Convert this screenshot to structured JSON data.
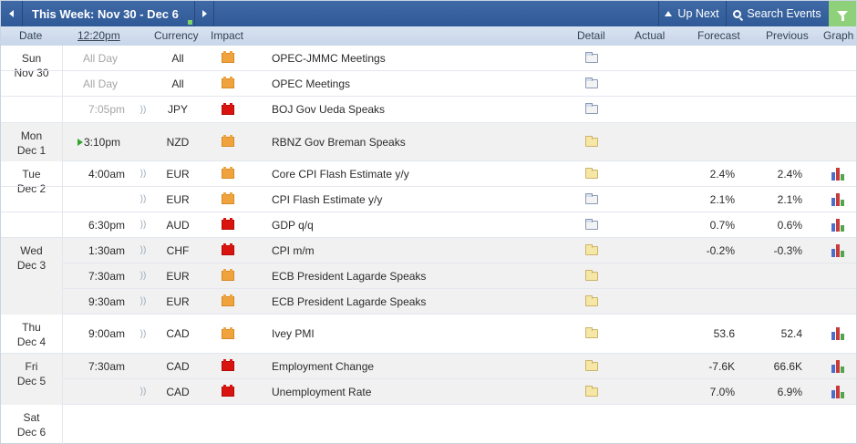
{
  "toolbar": {
    "week_label": "This Week: Nov 30 - Dec 6",
    "up_next_label": "Up Next",
    "search_label": "Search Events"
  },
  "columns": {
    "date": "Date",
    "time": "12:20pm",
    "currency": "Currency",
    "impact": "Impact",
    "detail": "Detail",
    "actual": "Actual",
    "forecast": "Forecast",
    "previous": "Previous",
    "graph": "Graph"
  },
  "days": [
    {
      "day": "Sun",
      "date": "Nov 30"
    },
    {
      "day": "Mon",
      "date": "Dec 1"
    },
    {
      "day": "Tue",
      "date": "Dec 2"
    },
    {
      "day": "Wed",
      "date": "Dec 3"
    },
    {
      "day": "Thu",
      "date": "Dec 4"
    },
    {
      "day": "Fri",
      "date": "Dec 5"
    },
    {
      "day": "Sat",
      "date": "Dec 6"
    }
  ],
  "events": [
    {
      "time": "All Day",
      "currency": "All",
      "impact": "orange",
      "event": "OPEC-JMMC Meetings",
      "forecast": "",
      "previous": ""
    },
    {
      "time": "All Day",
      "currency": "All",
      "impact": "orange",
      "event": "OPEC Meetings",
      "forecast": "",
      "previous": ""
    },
    {
      "time": "7:05pm",
      "currency": "JPY",
      "impact": "red",
      "event": "BOJ Gov Ueda Speaks",
      "forecast": "",
      "previous": ""
    },
    {
      "time": "3:10pm",
      "currency": "NZD",
      "impact": "orange",
      "event": "RBNZ Gov Breman Speaks",
      "forecast": "",
      "previous": ""
    },
    {
      "time": "4:00am",
      "currency": "EUR",
      "impact": "orange",
      "event": "Core CPI Flash Estimate y/y",
      "forecast": "2.4%",
      "previous": "2.4%"
    },
    {
      "time": "",
      "currency": "EUR",
      "impact": "orange",
      "event": "CPI Flash Estimate y/y",
      "forecast": "2.1%",
      "previous": "2.1%"
    },
    {
      "time": "6:30pm",
      "currency": "AUD",
      "impact": "red",
      "event": "GDP q/q",
      "forecast": "0.7%",
      "previous": "0.6%"
    },
    {
      "time": "1:30am",
      "currency": "CHF",
      "impact": "red",
      "event": "CPI m/m",
      "forecast": "-0.2%",
      "previous": "-0.3%"
    },
    {
      "time": "7:30am",
      "currency": "EUR",
      "impact": "orange",
      "event": "ECB President Lagarde Speaks",
      "forecast": "",
      "previous": ""
    },
    {
      "time": "9:30am",
      "currency": "EUR",
      "impact": "orange",
      "event": "ECB President Lagarde Speaks",
      "forecast": "",
      "previous": ""
    },
    {
      "time": "9:00am",
      "currency": "CAD",
      "impact": "orange",
      "event": "Ivey PMI",
      "forecast": "53.6",
      "previous": "52.4"
    },
    {
      "time": "7:30am",
      "currency": "CAD",
      "impact": "red",
      "event": "Employment Change",
      "forecast": "-7.6K",
      "previous": "66.6K"
    },
    {
      "time": "",
      "currency": "CAD",
      "impact": "red",
      "event": "Unemployment Rate",
      "forecast": "7.0%",
      "previous": "6.9%"
    }
  ],
  "colors": {
    "toolbar_bg": "#2f5a97",
    "header_bg": "#c8d6ea",
    "impact_high": "#d9140e",
    "impact_medium": "#f0a33c",
    "filter_bg": "#8fd07b"
  }
}
